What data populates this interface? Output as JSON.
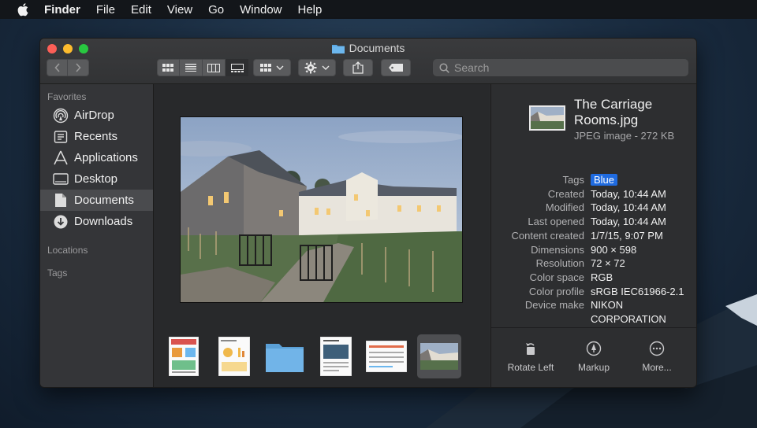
{
  "menubar": {
    "app_name": "Finder",
    "items": [
      "File",
      "Edit",
      "View",
      "Go",
      "Window",
      "Help"
    ]
  },
  "window": {
    "title": "Documents",
    "search_placeholder": "Search"
  },
  "sidebar": {
    "favorites_header": "Favorites",
    "items": [
      {
        "label": "AirDrop",
        "icon": "airdrop-icon"
      },
      {
        "label": "Recents",
        "icon": "recents-icon"
      },
      {
        "label": "Applications",
        "icon": "applications-icon"
      },
      {
        "label": "Desktop",
        "icon": "desktop-icon"
      },
      {
        "label": "Documents",
        "icon": "documents-icon",
        "selected": true
      },
      {
        "label": "Downloads",
        "icon": "downloads-icon"
      }
    ],
    "locations_header": "Locations",
    "tags_header": "Tags"
  },
  "info": {
    "file_name": "The Carriage Rooms.jpg",
    "file_kind": "JPEG image - 272 KB",
    "tags_label": "Tags",
    "tag_value": "Blue",
    "tag_color": "#1f6be0",
    "rows": [
      {
        "k": "Created",
        "v": "Today, 10:44 AM"
      },
      {
        "k": "Modified",
        "v": "Today, 10:44 AM"
      },
      {
        "k": "Last opened",
        "v": "Today, 10:44 AM"
      },
      {
        "k": "Content created",
        "v": "1/7/15, 9:07 PM"
      },
      {
        "k": "Dimensions",
        "v": "900 × 598"
      },
      {
        "k": "Resolution",
        "v": "72 × 72"
      },
      {
        "k": "Color space",
        "v": "RGB"
      },
      {
        "k": "Color profile",
        "v": "sRGB IEC61966-2.1"
      },
      {
        "k": "Device make",
        "v": "NIKON CORPORATION"
      }
    ],
    "actions": {
      "rotate_left": "Rotate Left",
      "markup": "Markup",
      "more": "More..."
    }
  }
}
